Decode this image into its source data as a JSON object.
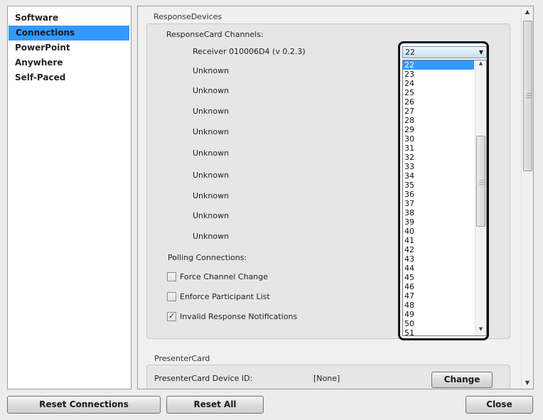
{
  "nav": {
    "items": [
      {
        "label": "Software",
        "selected": false
      },
      {
        "label": "Connections",
        "selected": true
      },
      {
        "label": "PowerPoint",
        "selected": false
      },
      {
        "label": "Anywhere",
        "selected": false
      },
      {
        "label": "Self-Paced",
        "selected": false
      }
    ]
  },
  "response_devices": {
    "section_title": "ResponseDevices",
    "channels_label": "ResponseCard Channels:",
    "receivers": [
      "Receiver 010006D4 (v 0.2.3)",
      "Unknown",
      "Unknown",
      "Unknown",
      "Unknown",
      "Unknown",
      "Unknown",
      "Unknown",
      "Unknown",
      "Unknown"
    ],
    "polling_label": "Polling Connections:",
    "checkboxes": [
      {
        "label": "Force Channel Change",
        "checked": false
      },
      {
        "label": "Enforce Participant List",
        "checked": false
      },
      {
        "label": "Invalid Response Notifications",
        "checked": true
      }
    ]
  },
  "channel_dropdown": {
    "selected_value": "22",
    "options": [
      "22",
      "23",
      "24",
      "25",
      "26",
      "27",
      "28",
      "29",
      "30",
      "31",
      "32",
      "33",
      "34",
      "35",
      "36",
      "37",
      "38",
      "39",
      "40",
      "41",
      "42",
      "43",
      "44",
      "45",
      "46",
      "47",
      "48",
      "49",
      "50",
      "51"
    ]
  },
  "presenter_card": {
    "section_title": "PresenterCard",
    "device_id_label": "PresenterCard Device ID:",
    "device_id_value": "[None]",
    "change_label": "Change"
  },
  "footer": {
    "reset_connections_label": "Reset Connections",
    "reset_all_label": "Reset All",
    "close_label": "Close"
  },
  "colors": {
    "selection": "#3399ff",
    "highlight_frame": "#111111"
  }
}
